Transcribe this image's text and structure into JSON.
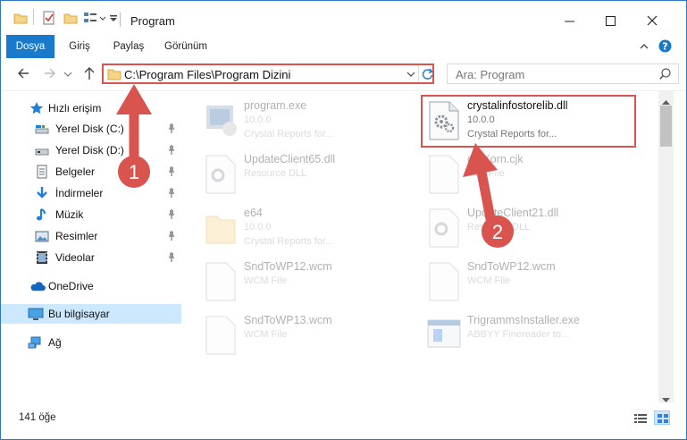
{
  "window": {
    "title": "Program",
    "accent": "#1979ca",
    "highlight_color": "#d9534f"
  },
  "ribbon": {
    "tabs": [
      {
        "label": "Dosya"
      },
      {
        "label": "Giriş"
      },
      {
        "label": "Paylaş"
      },
      {
        "label": "Görünüm"
      }
    ]
  },
  "address": {
    "path": "C:\\Program Files\\Program Dizini",
    "search_placeholder": "Ara: Program"
  },
  "sidebar": {
    "items": [
      {
        "label": "Hızlı erişim",
        "icon": "star-icon"
      },
      {
        "label": "Yerel Disk (C:)",
        "icon": "drive-icon"
      },
      {
        "label": "Yerel Disk (D:)",
        "icon": "drive-icon"
      },
      {
        "label": "Belgeler",
        "icon": "documents-icon"
      },
      {
        "label": "İndirmeler",
        "icon": "download-icon"
      },
      {
        "label": "Müzik",
        "icon": "music-icon"
      },
      {
        "label": "Resimler",
        "icon": "pictures-icon"
      },
      {
        "label": "Videolar",
        "icon": "videos-icon"
      },
      {
        "label": "OneDrive",
        "icon": "cloud-icon"
      },
      {
        "label": "Bu bilgisayar",
        "icon": "computer-icon"
      },
      {
        "label": "Ağ",
        "icon": "network-icon"
      }
    ]
  },
  "files": [
    {
      "name": "program.exe",
      "line2": "10.0.0",
      "line3": "Crystal Reports for..."
    },
    {
      "name": "crystalinfostorelib.dll",
      "line2": "10.0.0",
      "line3": "Crystal Reports for..."
    },
    {
      "name": "UpdateClient65.dll",
      "line2": "Resource DLL",
      "line3": ""
    },
    {
      "name": "dotKorn.cjk",
      "line2": "CJK File",
      "line3": ""
    },
    {
      "name": "e64",
      "line2": "10.0.0",
      "line3": "Crystal Reports for..."
    },
    {
      "name": "UpdateClient21.dll",
      "line2": "Resource DLL",
      "line3": ""
    },
    {
      "name": "SndToWP12.wcm",
      "line2": "WCM File",
      "line3": ""
    },
    {
      "name": "SndToWP12.wcm",
      "line2": "WCM File",
      "line3": ""
    },
    {
      "name": "SndToWP13.wcm",
      "line2": "WCM File",
      "line3": ""
    },
    {
      "name": "TrigrammsInstaller.exe",
      "line2": "ABBYY Finereader to...",
      "line3": ""
    }
  ],
  "status": {
    "item_count": "141 öğe"
  },
  "annotations": {
    "step1": "1",
    "step2": "2"
  }
}
